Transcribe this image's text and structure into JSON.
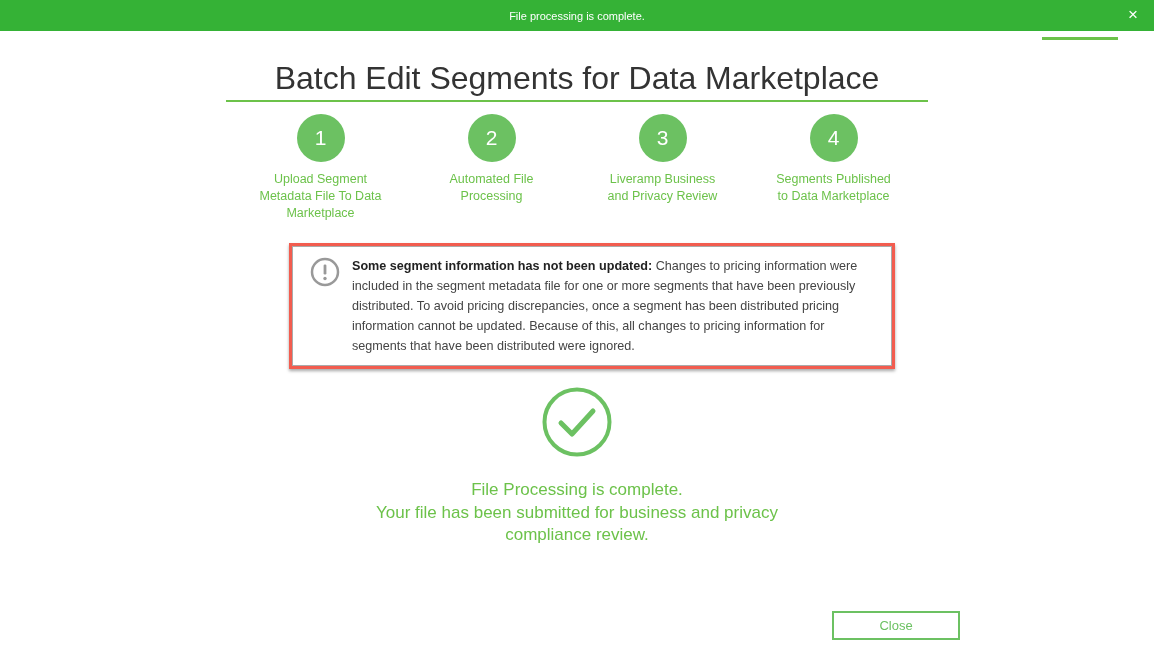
{
  "banner": {
    "message": "File processing is complete.",
    "close_icon": "×"
  },
  "title": "Batch Edit Segments for Data Marketplace",
  "steps": [
    {
      "number": "1",
      "label": "Upload Segment\nMetadata File To Data\nMarketplace"
    },
    {
      "number": "2",
      "label": "Automated File\nProcessing"
    },
    {
      "number": "3",
      "label": "Liveramp Business\nand Privacy Review"
    },
    {
      "number": "4",
      "label": "Segments Published\nto Data Marketplace"
    }
  ],
  "alert": {
    "text": "**Some segment information has not been updated:** Changes to pricing information were included in the segment metadata file for one or more segments that have been previously distributed. To avoid pricing discrepancies, once a segment has been distributed pricing information cannot be updated. Because of this, all changes to pricing information for segments that have been distributed were ignored."
  },
  "completion": [
    "File Processing is complete.",
    "Your file has been submitted for business and privacy compliance review."
  ],
  "close_button": "Close"
}
